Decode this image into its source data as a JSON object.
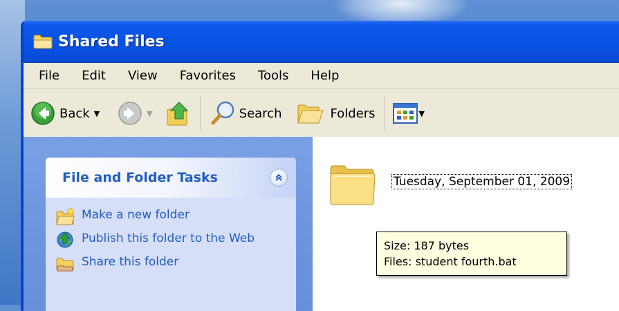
{
  "window": {
    "title": "Shared Files"
  },
  "menubar": {
    "items": [
      "File",
      "Edit",
      "View",
      "Favorites",
      "Tools",
      "Help"
    ]
  },
  "toolbar": {
    "back_label": "Back",
    "search_label": "Search",
    "folders_label": "Folders",
    "icons": [
      "back-arrow-icon",
      "forward-arrow-icon",
      "up-folder-icon",
      "search-magnifier-icon",
      "folders-icon",
      "views-icon"
    ]
  },
  "sidebar": {
    "panel_title": "File and Folder Tasks",
    "tasks": [
      {
        "label": "Make a new folder",
        "icon": "new-folder-icon"
      },
      {
        "label": "Publish this folder to the Web",
        "icon": "publish-web-icon"
      },
      {
        "label": "Share this folder",
        "icon": "share-folder-icon"
      }
    ]
  },
  "content": {
    "folder_name": "Tuesday, September 01, 2009",
    "tooltip": {
      "line1": "Size: 187 bytes",
      "line2": "Files: student fourth.bat"
    }
  },
  "colors": {
    "titlebar": "#0852e3",
    "sidebar": "#6b94dd",
    "task_link": "#215dc6",
    "tooltip_bg": "#ffffe1",
    "chrome": "#ece9d8"
  }
}
